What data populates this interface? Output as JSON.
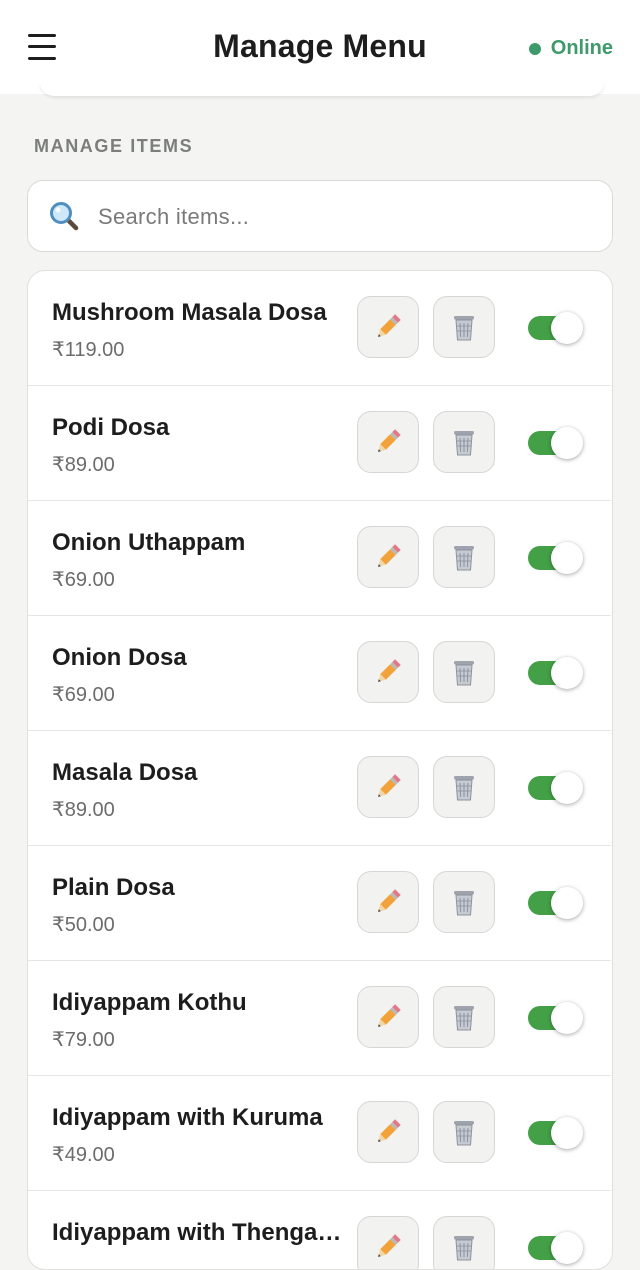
{
  "header": {
    "title": "Manage Menu",
    "status": "Online",
    "status_color": "#3f9a6b"
  },
  "section": {
    "label": "MANAGE ITEMS"
  },
  "search": {
    "placeholder": "Search items..."
  },
  "icons": {
    "menu": "hamburger-menu-icon",
    "search": "search-icon",
    "edit": "pencil-icon",
    "delete": "trash-icon"
  },
  "accent": {
    "toggle_on": "#43a047"
  },
  "items": [
    {
      "name": "Mushroom Masala Dosa",
      "price": "₹119.00",
      "enabled": true
    },
    {
      "name": "Podi Dosa",
      "price": "₹89.00",
      "enabled": true
    },
    {
      "name": "Onion Uthappam",
      "price": "₹69.00",
      "enabled": true
    },
    {
      "name": "Onion Dosa",
      "price": "₹69.00",
      "enabled": true
    },
    {
      "name": "Masala Dosa",
      "price": "₹89.00",
      "enabled": true
    },
    {
      "name": "Plain Dosa",
      "price": "₹50.00",
      "enabled": true
    },
    {
      "name": "Idiyappam Kothu",
      "price": "₹79.00",
      "enabled": true
    },
    {
      "name": "Idiyappam with Kuruma",
      "price": "₹49.00",
      "enabled": true
    },
    {
      "name": "Idiyappam with Thengapal",
      "price": "",
      "enabled": true
    }
  ]
}
